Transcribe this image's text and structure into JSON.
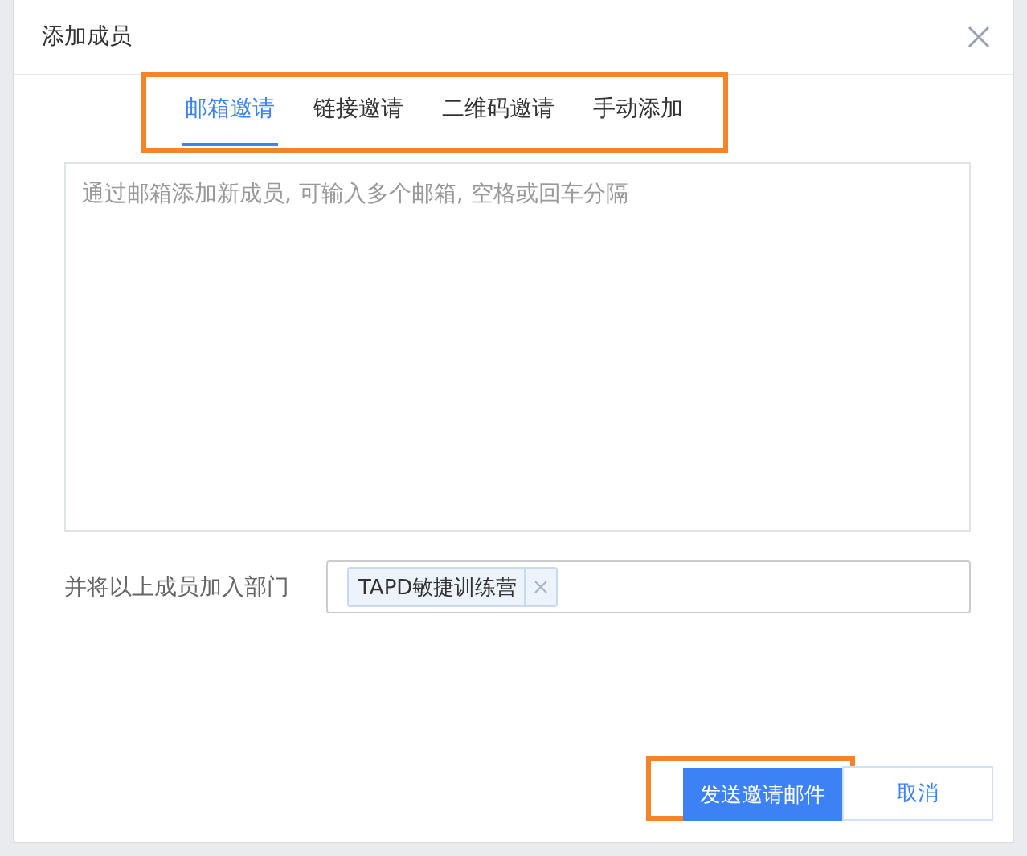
{
  "dialog": {
    "title": "添加成员"
  },
  "tabs": [
    {
      "label": "邮箱邀请",
      "selected": true
    },
    {
      "label": "链接邀请",
      "selected": false
    },
    {
      "label": "二维码邀请",
      "selected": false
    },
    {
      "label": "手动添加",
      "selected": false
    }
  ],
  "email_field": {
    "placeholder": "通过邮箱添加新成员, 可输入多个邮箱, 空格或回车分隔"
  },
  "department": {
    "label": "并将以上成员加入部门",
    "tags": [
      "TAPD敏捷训练营"
    ]
  },
  "buttons": {
    "send": "发送邀请邮件",
    "cancel": "取消"
  }
}
